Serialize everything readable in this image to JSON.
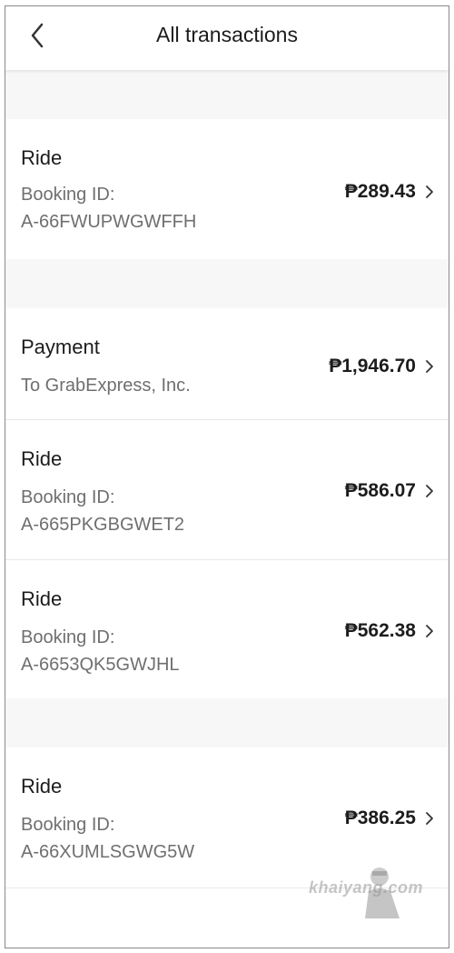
{
  "header": {
    "title": "All transactions",
    "back_icon": "chevron-left-icon"
  },
  "transactions": [
    {
      "title": "Ride",
      "sub_label": "Booking ID:",
      "sub_value": "A-66FWUPWGWFFH",
      "amount": "₱289.43"
    },
    {
      "title": "Payment",
      "sub_label": "To GrabExpress, Inc.",
      "amount": "₱1,946.70"
    },
    {
      "title": "Ride",
      "sub_label": "Booking ID:",
      "sub_value": "A-665PKGBGWET2",
      "amount": "₱586.07"
    },
    {
      "title": "Ride",
      "sub_label": "Booking ID:",
      "sub_value": "A-6653QK5GWJHL",
      "amount": "₱562.38"
    },
    {
      "title": "Ride",
      "sub_label": "Booking ID:",
      "sub_value": "A-66XUMLSGWG5W",
      "amount": "₱386.25"
    }
  ],
  "watermark": "khaiyang.com",
  "colors": {
    "background": "#f7f7f7",
    "card": "#ffffff",
    "text_primary": "#1c1c1c",
    "text_secondary": "#6f6f6f"
  }
}
